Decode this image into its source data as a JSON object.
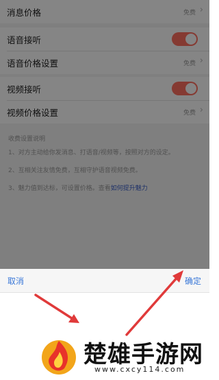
{
  "settings": {
    "message_price": {
      "label": "消息价格",
      "value": "免费"
    },
    "voice_answer": {
      "label": "语音接听",
      "on": true
    },
    "voice_price": {
      "label": "语音价格设置",
      "value": "免费"
    },
    "video_answer": {
      "label": "视频接听",
      "on": true
    },
    "video_price": {
      "label": "视频价格设置",
      "value": "免费"
    }
  },
  "notes": {
    "title": "收费设置说明",
    "items": [
      "1、对方主动给你发消息、打语音/视频等，按照对方的设定。",
      "2、互相关注友情免费，互相守护语音视频免费。",
      "3、魅力值到达标，可设置价格。查看"
    ],
    "link": "如何提升魅力"
  },
  "sheet": {
    "cancel": "取消",
    "confirm": "确定"
  },
  "watermark": {
    "title": "楚雄手游网",
    "url": "www.cxcy114.com"
  },
  "colors": {
    "toggle_on": "#ff6f61",
    "action": "#3a78d8",
    "arrow": "#e03a3a"
  }
}
